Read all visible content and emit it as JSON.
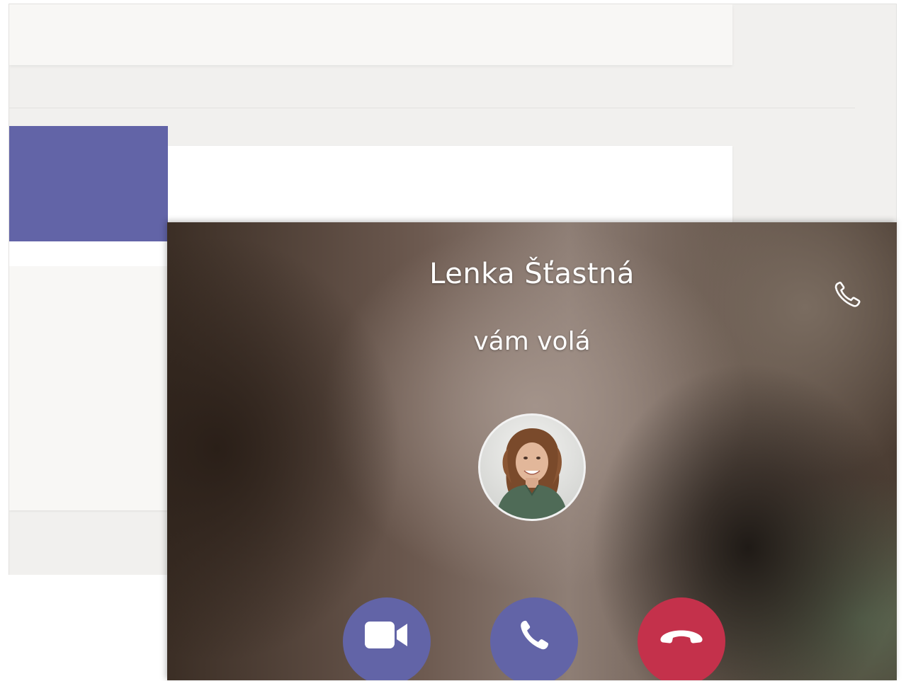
{
  "call": {
    "caller_name": "Lenka Šťastná",
    "status_text": "vám volá",
    "indicator_icon": "phone-outline-icon",
    "avatar_icon": "caller-photo",
    "colors": {
      "accent": "#6264a7",
      "decline": "#c4314b"
    },
    "actions": [
      {
        "name": "accept-video",
        "icon": "video-camera-icon"
      },
      {
        "name": "accept-audio",
        "icon": "phone-icon"
      },
      {
        "name": "decline",
        "icon": "hang-up-icon"
      }
    ]
  }
}
